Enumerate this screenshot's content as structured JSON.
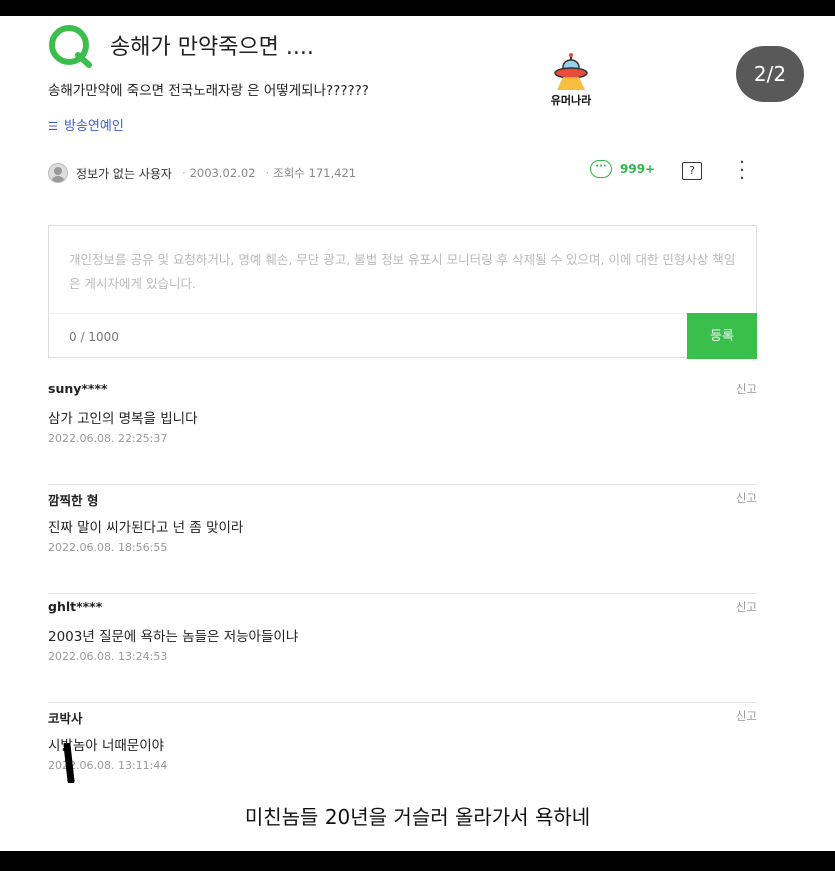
{
  "question": {
    "title": "송해가 만약죽으면 ....",
    "body": "송해가만약에 죽으면 전국노래자랑 은 어떻게되나??????",
    "category": "방송연예인",
    "author": "정보가 없는 사용자",
    "date": "2003.02.02",
    "views": "조회수 171,421",
    "comment_count": "999+"
  },
  "watermark": {
    "text": "유머나라"
  },
  "page_indicator": "2/2",
  "composer": {
    "placeholder": "개인정보를 공유 및 요청하거나, 명예 훼손, 무단 광고, 불법 정보 유포시 모니터링 후 삭제될 수 있으며, 이에 대한 민형사상 책임은 게시자에게 있습니다.",
    "counter": "0 / 1000",
    "submit_label": "등록"
  },
  "comments": [
    {
      "user": "suny****",
      "body": "삼가 고인의 명복을 빕니다",
      "date": "2022.06.08. 22:25:37",
      "report": "신고"
    },
    {
      "user": "깜찍한 형",
      "body": "진짜 말이 씨가된다고 넌 좀 맞이라",
      "date": "2022.06.08. 18:56:55",
      "report": "신고"
    },
    {
      "user": "ghlt****",
      "body": "2003년 질문에 욕하는 놈들은 저능아들이냐",
      "date": "2022.06.08. 13:24:53",
      "report": "신고"
    },
    {
      "user": "코박사",
      "body": "시발놈아 너때문이야",
      "date": "2022.06.08. 13:11:44",
      "report": "신고"
    }
  ],
  "caption": "미친놈들 20년을 거슬러 올라가서 욕하네",
  "colors": {
    "accent_green": "#3bbf4c",
    "link_blue": "#3b5fcc"
  }
}
